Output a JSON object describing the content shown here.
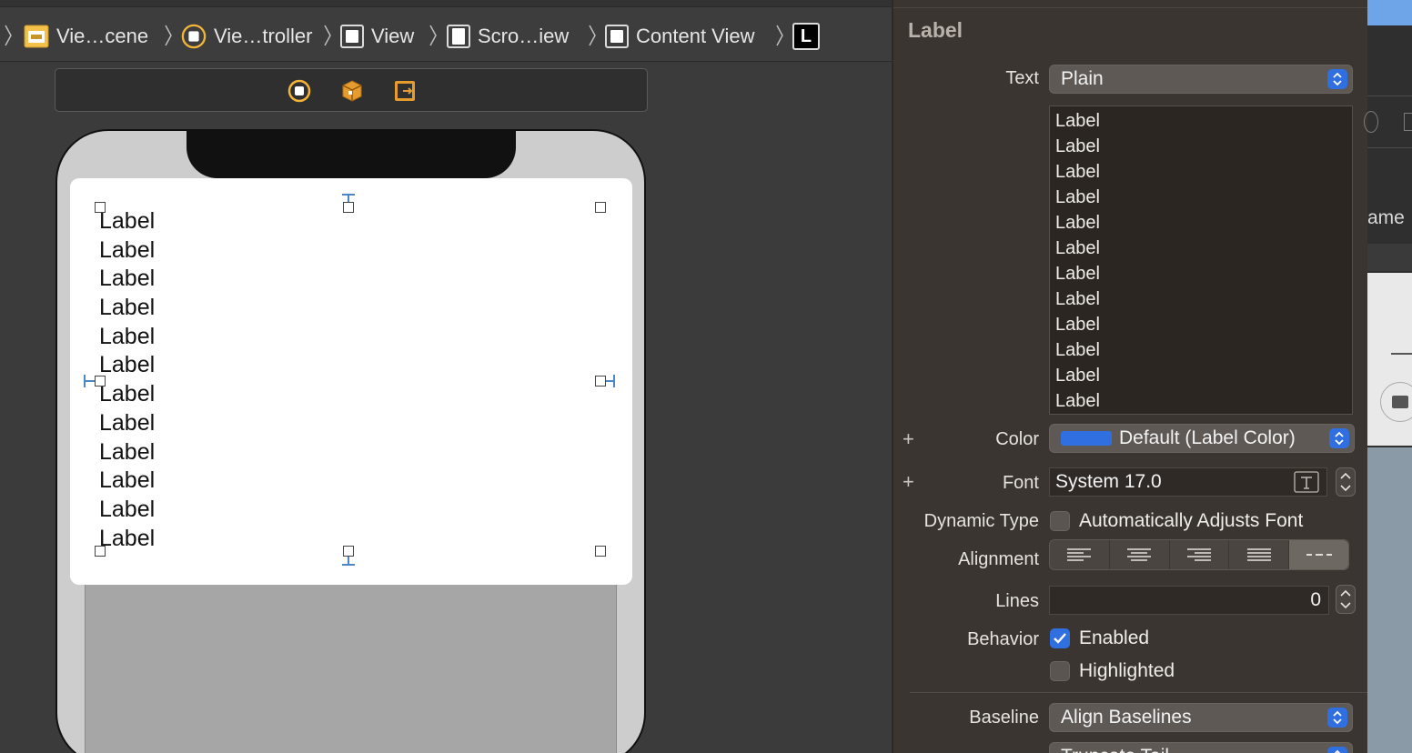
{
  "breadcrumb": {
    "items": [
      {
        "label": "Vie…cene",
        "icon": "scene-icon"
      },
      {
        "label": "Vie…troller",
        "icon": "view-controller-icon"
      },
      {
        "label": "View",
        "icon": "view-icon"
      },
      {
        "label": "Scro…iew",
        "icon": "scroll-view-icon"
      },
      {
        "label": "Content View",
        "icon": "view-icon"
      },
      {
        "label": "L",
        "icon": "label-icon"
      }
    ]
  },
  "scene_dock": {
    "icons": [
      "view-controller-icon",
      "first-responder-icon",
      "exit-icon"
    ]
  },
  "canvas": {
    "labels": [
      "Label",
      "Label",
      "Label",
      "Label",
      "Label",
      "Label",
      "Label",
      "Label",
      "Label",
      "Label",
      "Label",
      "Label"
    ]
  },
  "inspector": {
    "section_title": "Label",
    "text_label": "Text",
    "text_type": "Plain",
    "text_lines": [
      "Label",
      "Label",
      "Label",
      "Label",
      "Label",
      "Label",
      "Label",
      "Label",
      "Label",
      "Label",
      "Label",
      "Label"
    ],
    "color_label": "Color",
    "color_value": "Default (Label Color)",
    "color_swatch": "#2f6fe0",
    "font_label": "Font",
    "font_value": "System 17.0",
    "dynamic_type_label": "Dynamic Type",
    "dynamic_type_option": "Automatically Adjusts Font",
    "alignment_label": "Alignment",
    "alignment_options": [
      "left",
      "center",
      "right",
      "justified",
      "natural"
    ],
    "lines_label": "Lines",
    "lines_value": "0",
    "behavior_label": "Behavior",
    "behavior_enabled": "Enabled",
    "behavior_highlighted": "Highlighted",
    "baseline_label": "Baseline",
    "baseline_value": "Align Baselines",
    "line_break_value": "Truncate Tail"
  },
  "side_strip": {
    "partial_text": "ame"
  },
  "colors": {
    "accent": "#2f6fe0",
    "inspector_bg": "#3a3530",
    "canvas_bg": "#3b3b3b"
  }
}
